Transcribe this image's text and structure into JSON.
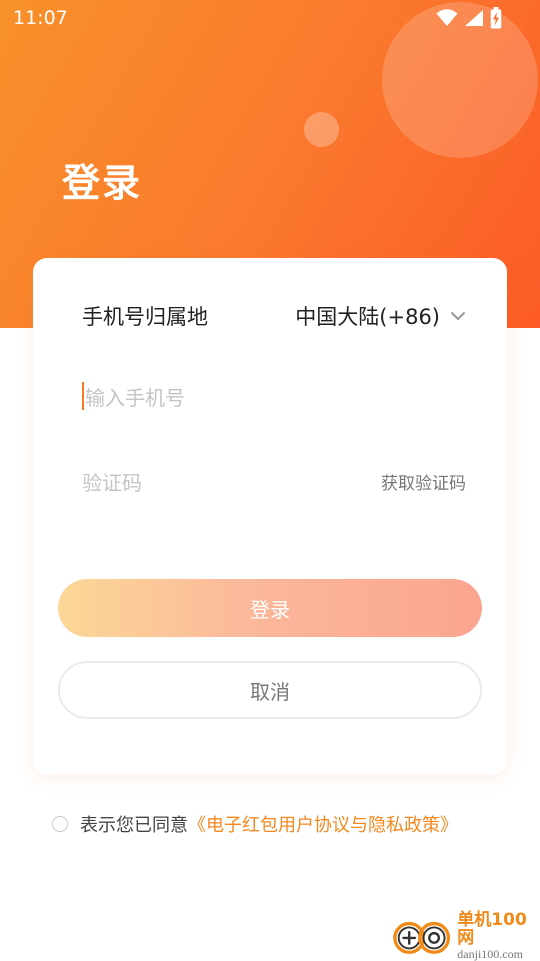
{
  "status_bar": {
    "time": "11:07",
    "icons": [
      "wifi-icon",
      "signal-icon",
      "battery-charging-icon"
    ]
  },
  "header": {
    "title": "登录"
  },
  "form": {
    "region_label": "手机号归属地",
    "region_value": "中国大陆(+86)",
    "phone_placeholder": "输入手机号",
    "code_placeholder": "验证码",
    "get_code_label": "获取验证码",
    "login_label": "登录",
    "cancel_label": "取消"
  },
  "agreement": {
    "prefix": "表示您已同意",
    "link": "《电子红包用户协议与隐私政策》",
    "checked": false
  },
  "watermark": {
    "name": "单机100网",
    "domain": "danji100.com"
  },
  "colors": {
    "header_gradient_start": "#f8912a",
    "header_gradient_end": "#fc5a26",
    "accent": "#f5881f",
    "login_gradient_start": "#fbd796",
    "login_gradient_end": "#fba58f"
  }
}
